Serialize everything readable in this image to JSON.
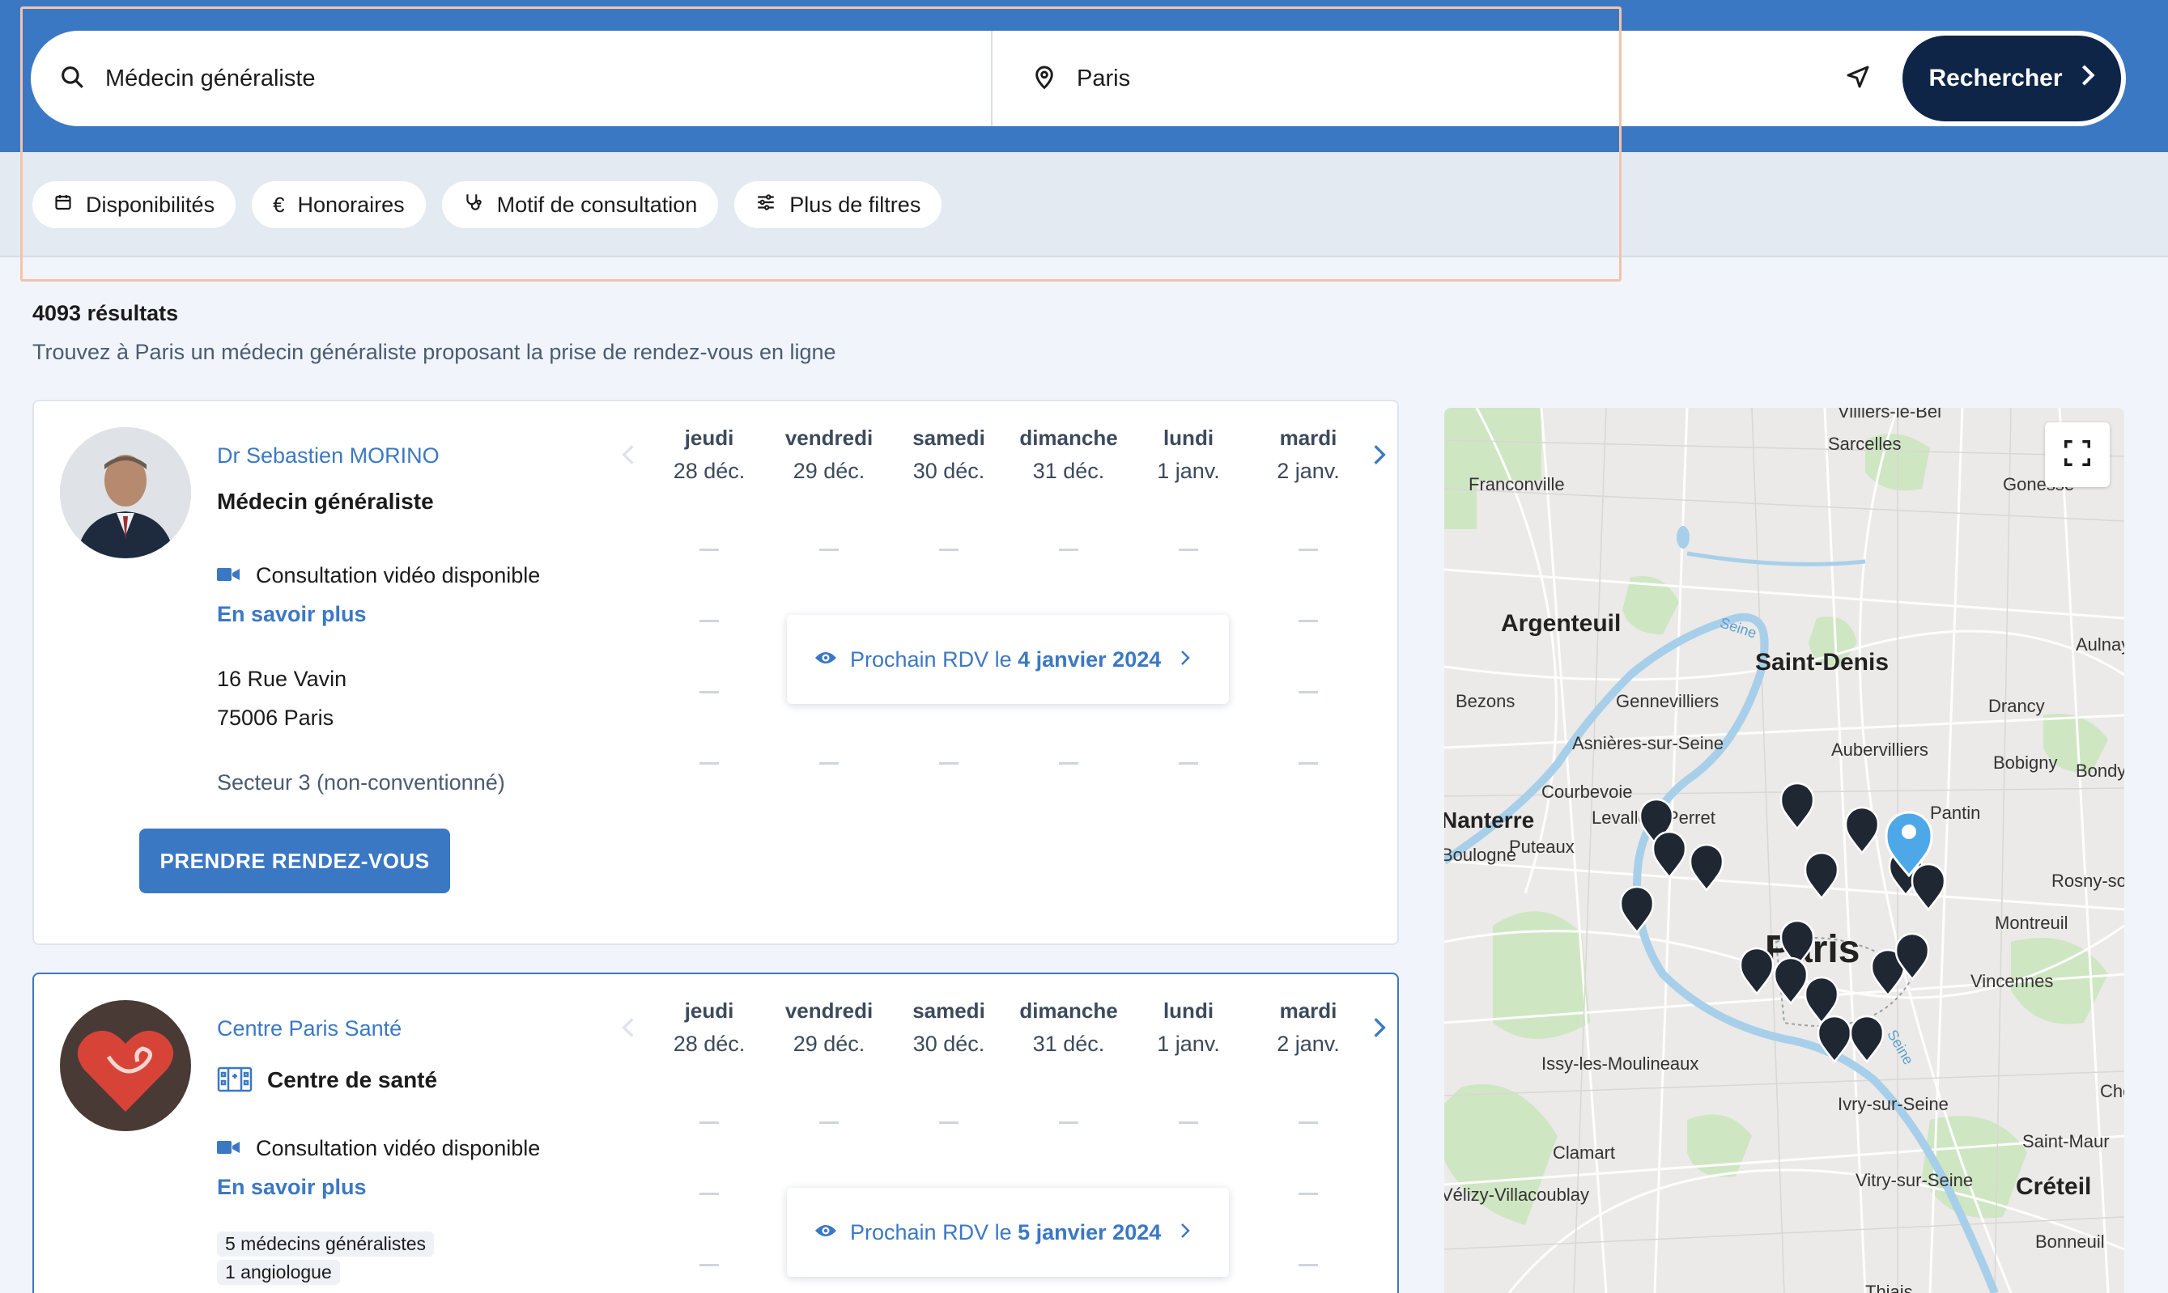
{
  "search": {
    "what_value": "Médecin généraliste",
    "where_value": "Paris",
    "button_label": "Rechercher"
  },
  "filters": {
    "chips": [
      "Disponibilités",
      "Honoraires",
      "Motif de consultation",
      "Plus de filtres"
    ]
  },
  "results": {
    "count": "4093 résultats",
    "subtitle": "Trouvez à Paris un médecin généraliste proposant la prise de rendez-vous en ligne"
  },
  "calendar": {
    "days": [
      {
        "name": "jeudi",
        "date": "28 déc."
      },
      {
        "name": "vendredi",
        "date": "29 déc."
      },
      {
        "name": "samedi",
        "date": "30 déc."
      },
      {
        "name": "dimanche",
        "date": "31 déc."
      },
      {
        "name": "lundi",
        "date": "1 janv."
      },
      {
        "name": "mardi",
        "date": "2 janv."
      }
    ]
  },
  "cards": [
    {
      "name": "Dr Sebastien MORINO",
      "specialty": "Médecin généraliste",
      "video": "Consultation vidéo disponible",
      "learn_more": "En savoir plus",
      "address_line1": "16 Rue Vavin",
      "address_line2": "75006 Paris",
      "sector": "Secteur 3 (non-conventionné)",
      "book_label": "PRENDRE RENDEZ-VOUS",
      "next_prefix": "Prochain RDV le",
      "next_date": "4 janvier 2024"
    },
    {
      "name": "Centre Paris Santé",
      "specialty": "Centre de santé",
      "video": "Consultation vidéo disponible",
      "learn_more": "En savoir plus",
      "tags": [
        "5 médecins généralistes",
        "1 angiologue"
      ],
      "next_prefix": "Prochain RDV le",
      "next_date": "5 janvier 2024"
    }
  ],
  "map": {
    "labels": [
      "Villiers-le-Bel",
      "Sarcelles",
      "Franconville",
      "Gonesse",
      "Argenteuil",
      "Saint-Denis",
      "Aulnay",
      "Seine",
      "Bezons",
      "Gennevilliers",
      "Drancy",
      "Asnières-sur-Seine",
      "Aubervilliers",
      "Bobigny",
      "Bondy",
      "Courbevoie",
      "Pantin",
      "Nanterre",
      "Levallois-Perret",
      "Puteaux",
      "Rosny-sous-Bois",
      "Boulogne",
      "Montreuil",
      "Paris",
      "Vincennes",
      "Issy-les-Moulineaux",
      "Seine",
      "Choisy",
      "Ivry-sur-Seine",
      "Saint-Maur",
      "Clamart",
      "Vitry-sur-Seine",
      "Créteil",
      "Vélizy-Villacoublay",
      "Bonneuil",
      "Thiais"
    ],
    "accent_color": "#4ea8e8",
    "pin_color": "#1f2733"
  }
}
